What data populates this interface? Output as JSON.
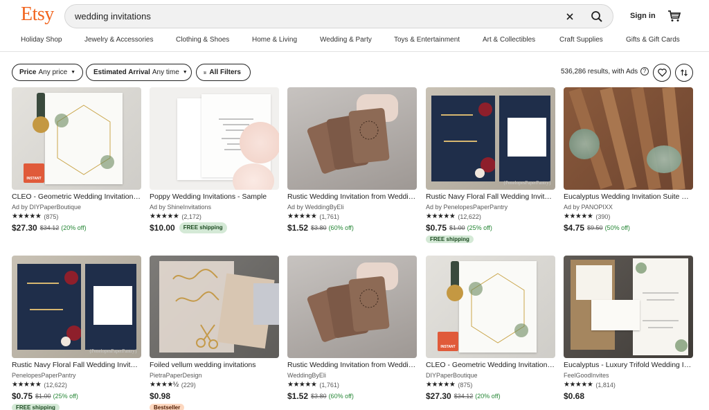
{
  "header": {
    "logo": "Etsy",
    "search_value": "wedding invitations",
    "signin": "Sign in"
  },
  "categories": [
    "Holiday Shop",
    "Jewelry & Accessories",
    "Clothing & Shoes",
    "Home & Living",
    "Wedding & Party",
    "Toys & Entertainment",
    "Art & Collectibles",
    "Craft Supplies",
    "Gifts & Gift Cards"
  ],
  "filters": {
    "price_label": "Price",
    "price_value": "Any price",
    "arrival_label": "Estimated Arrival",
    "arrival_value": "Any time",
    "all_filters": "All Filters",
    "results": "536,286 results, with Ads"
  },
  "listings": [
    {
      "title": "CLEO - Geometric Wedding Invitation Template",
      "seller": "Ad by DIYPaperBoutique",
      "stars": "★★★★★",
      "count": "(875)",
      "price": "$27.30",
      "orig": "$34.12",
      "off": "(20% off)",
      "badge": "",
      "instant": "INSTANT",
      "watermark": ""
    },
    {
      "title": "Poppy Wedding Invitations - Sample",
      "seller": "Ad by ShineInvitations",
      "stars": "★★★★★",
      "count": "(2,172)",
      "price": "$10.00",
      "orig": "",
      "off": "",
      "badge_inline": "FREE shipping",
      "instant": "",
      "watermark": ""
    },
    {
      "title": "Rustic Wedding Invitation from Wedding By Eli",
      "seller": "Ad by WeddingByEli",
      "stars": "★★★★★",
      "count": "(1,761)",
      "price": "$1.52",
      "orig": "$3.80",
      "off": "(60% off)",
      "badge": "",
      "instant": "",
      "watermark": ""
    },
    {
      "title": "Rustic Navy Floral Fall Wedding Invitations",
      "seller": "Ad by PenelopesPaperPantry",
      "stars": "★★★★★",
      "count": "(12,622)",
      "price": "$0.75",
      "orig": "$1.00",
      "off": "(25% off)",
      "badge": "FREE shipping",
      "instant": "",
      "watermark": "{PenelopesPaperPantry}"
    },
    {
      "title": "Eucalyptus Wedding Invitation Suite Wood",
      "seller": "Ad by PANOPIXX",
      "stars": "★★★★★",
      "count": "(390)",
      "price": "$4.75",
      "orig": "$9.50",
      "off": "(50% off)",
      "badge": "",
      "instant": "",
      "watermark": ""
    },
    {
      "title": "Rustic Navy Floral Fall Wedding Invitations",
      "seller": "PenelopesPaperPantry",
      "stars": "★★★★★",
      "count": "(12,622)",
      "price": "$0.75",
      "orig": "$1.00",
      "off": "(25% off)",
      "badge": "FREE shipping",
      "instant": "",
      "watermark": "{PenelopesPaperPantry}"
    },
    {
      "title": "Foiled vellum wedding invitations",
      "seller": "PietraPaperDesign",
      "stars": "★★★★½",
      "count": "(229)",
      "price": "$0.98",
      "orig": "",
      "off": "",
      "badge_best": "Bestseller",
      "instant": "",
      "watermark": ""
    },
    {
      "title": "Rustic Wedding Invitation from Wedding By Eli",
      "seller": "WeddingByEli",
      "stars": "★★★★★",
      "count": "(1,761)",
      "price": "$1.52",
      "orig": "$3.80",
      "off": "(60% off)",
      "badge": "",
      "instant": "",
      "watermark": ""
    },
    {
      "title": "CLEO - Geometric Wedding Invitation Template",
      "seller": "DIYPaperBoutique",
      "stars": "★★★★★",
      "count": "(875)",
      "price": "$27.30",
      "orig": "$34.12",
      "off": "(20% off)",
      "badge": "",
      "instant": "INSTANT",
      "watermark": ""
    },
    {
      "title": "Eucalyptus - Luxury Trifold Wedding Invitation",
      "seller": "FeelGoodInvites",
      "stars": "★★★★★",
      "count": "(1,814)",
      "price": "$0.68",
      "orig": "",
      "off": "",
      "badge": "",
      "instant": "",
      "watermark": ""
    }
  ],
  "colors": {
    "brand": "#f1641e",
    "discount": "#258635"
  }
}
